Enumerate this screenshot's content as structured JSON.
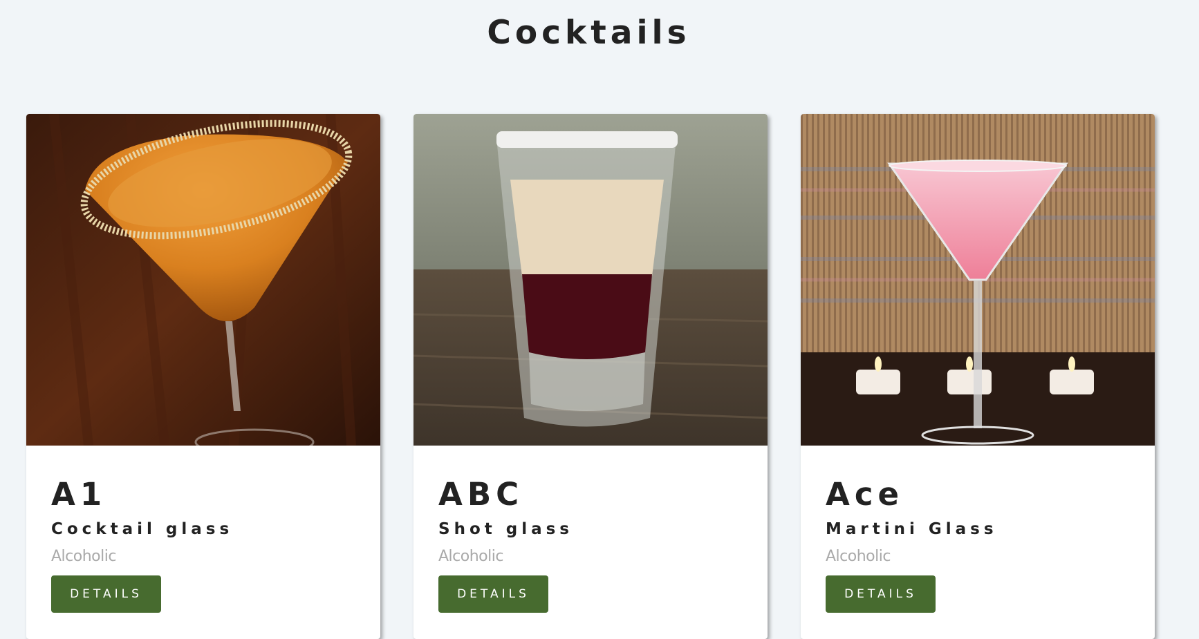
{
  "page": {
    "title": "Cocktails"
  },
  "cocktails": [
    {
      "name": "A1",
      "glass": "Cocktail glass",
      "info": "Alcoholic",
      "button_label": "DETAILS",
      "image_alt": "A1"
    },
    {
      "name": "ABC",
      "glass": "Shot glass",
      "info": "Alcoholic",
      "button_label": "DETAILS",
      "image_alt": "ABC"
    },
    {
      "name": "Ace",
      "glass": "Martini Glass",
      "info": "Alcoholic",
      "button_label": "DETAILS",
      "image_alt": "Ace"
    }
  ],
  "colors": {
    "background": "#f1f5f8",
    "card": "#ffffff",
    "button": "#476b2f",
    "text": "#222222",
    "muted_text": "#a9a9a9"
  }
}
